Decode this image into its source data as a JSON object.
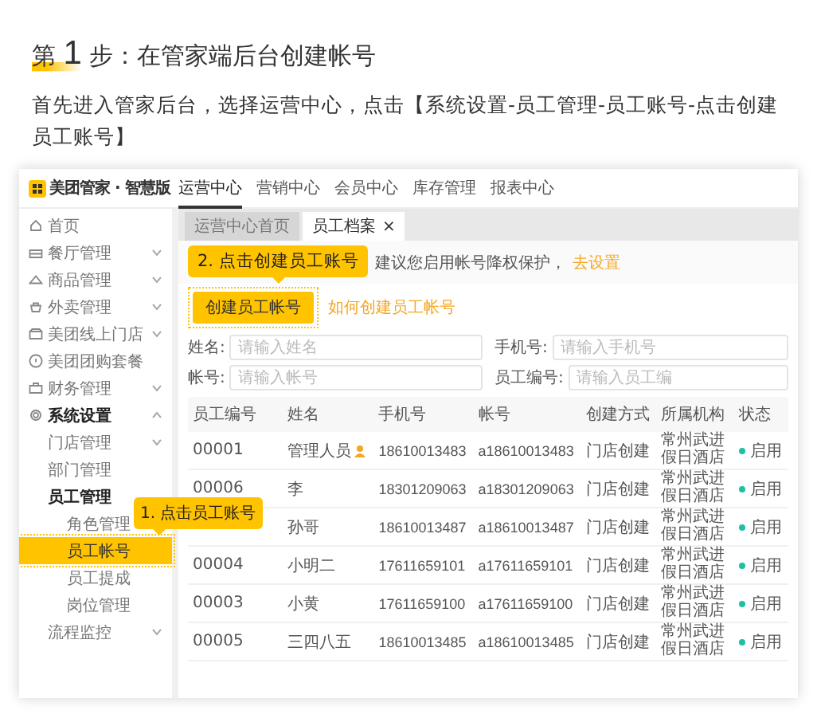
{
  "heading": {
    "prefix": "第",
    "number": "1",
    "text": "步：在管家端后台创建帐号"
  },
  "intro": "首先进入管家后台，选择运营中心，点击【系统设置-员工管理-员工账号-点击创建员工账号】",
  "app": {
    "logo": "美团管家 · 智慧版",
    "top_nav": [
      {
        "label": "运营中心",
        "selected": true
      },
      {
        "label": "营销中心",
        "selected": false
      },
      {
        "label": "会员中心",
        "selected": false
      },
      {
        "label": "库存管理",
        "selected": false
      },
      {
        "label": "报表中心",
        "selected": false
      }
    ],
    "sidebar": [
      {
        "label": "首页",
        "kind": "link",
        "selected": false
      },
      {
        "label": "餐厅管理",
        "kind": "menu",
        "expanded": false,
        "selected": false
      },
      {
        "label": "商品管理",
        "kind": "menu",
        "expanded": false,
        "selected": false
      },
      {
        "label": "外卖管理",
        "kind": "menu",
        "expanded": false,
        "selected": false
      },
      {
        "label": "美团线上门店",
        "kind": "menu",
        "expanded": false,
        "selected": false
      },
      {
        "label": "美团团购套餐",
        "kind": "link",
        "selected": false
      },
      {
        "label": "财务管理",
        "kind": "menu",
        "expanded": false,
        "selected": false
      },
      {
        "label": "系统设置",
        "kind": "menu",
        "expanded": true,
        "selected": false,
        "children": [
          {
            "label": "门店管理",
            "kind": "menu",
            "expanded": false,
            "selected": false
          },
          {
            "label": "部门管理",
            "kind": "link",
            "selected": false
          },
          {
            "label": "员工管理",
            "kind": "group",
            "selected": false,
            "children": [
              {
                "label": "角色管理",
                "selected": false
              },
              {
                "label": "员工帐号",
                "selected": true
              },
              {
                "label": "员工提成",
                "selected": false
              },
              {
                "label": "岗位管理",
                "selected": false
              }
            ]
          },
          {
            "label": "流程监控",
            "kind": "menu",
            "expanded": false,
            "selected": false
          }
        ]
      }
    ],
    "tabs": [
      {
        "label": "运营中心首页",
        "selected": false
      },
      {
        "label": "员工档案",
        "selected": true,
        "close": "×"
      }
    ],
    "callout_top": "2. 点击创建员工账号",
    "notice": {
      "text": "建议您启用帐号降权保护，",
      "link": "去设置"
    },
    "create_button": "创建员工帐号",
    "help_link": "如何创建员工帐号",
    "filters": [
      {
        "label": "姓名:",
        "placeholder": "请输入姓名"
      },
      {
        "label": "手机号:",
        "placeholder": "请输入手机号"
      },
      {
        "label": "帐号:",
        "placeholder": "请输入帐号"
      },
      {
        "label": "员工编号:",
        "placeholder": "请输入员工编"
      }
    ],
    "callout_side": "1. 点击员工账号",
    "table": {
      "columns": [
        "员工编号",
        "姓名",
        "手机号",
        "帐号",
        "创建方式",
        "所属机构",
        "状态"
      ],
      "rows": [
        {
          "id": "00001",
          "name": "管理人员",
          "admin_badge": true,
          "phone": "18610013483",
          "account": "a18610013483",
          "created_by": "门店创建",
          "org": "常州武进假日酒店",
          "status": "启用"
        },
        {
          "id": "00006",
          "name": "李",
          "admin_badge": false,
          "phone": "18301209063",
          "account": "a18301209063",
          "created_by": "门店创建",
          "org": "常州武进假日酒店",
          "status": "启用"
        },
        {
          "name": "孙哥",
          "admin_badge": false,
          "phone": "18610013487",
          "account": "a18610013487",
          "created_by": "门店创建",
          "org": "常州武进假日酒店",
          "status": "启用"
        },
        {
          "id": "00004",
          "name": "小明二",
          "admin_badge": false,
          "phone": "17611659101",
          "account": "a17611659101",
          "created_by": "门店创建",
          "org": "常州武进假日酒店",
          "status": "启用"
        },
        {
          "id": "00003",
          "name": "小黄",
          "admin_badge": false,
          "phone": "17611659100",
          "account": "a17611659100",
          "created_by": "门店创建",
          "org": "常州武进假日酒店",
          "status": "启用"
        },
        {
          "id": "00005",
          "name": "三四八五",
          "admin_badge": false,
          "phone": "18610013485",
          "account": "a18610013485",
          "created_by": "门店创建",
          "org": "常州武进假日酒店",
          "status": "启用"
        }
      ]
    }
  }
}
